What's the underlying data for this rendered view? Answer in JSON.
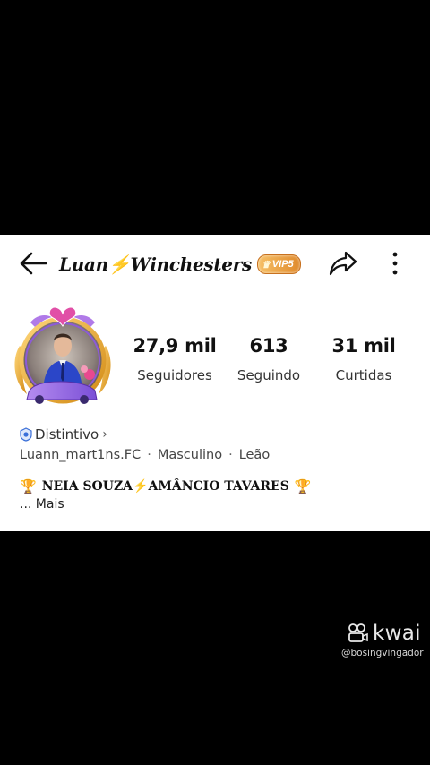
{
  "header": {
    "title": "Luan⚡Winchesters",
    "vip_label": "VIP5"
  },
  "stats": {
    "followers_value": "27,9 mil",
    "followers_label": "Seguidores",
    "following_value": "613",
    "following_label": "Seguindo",
    "likes_value": "31 mil",
    "likes_label": "Curtidas"
  },
  "profile": {
    "badge_label": "Distintivo",
    "username": "Luann_mart1ns.FC",
    "gender": "Masculino",
    "sign": "Leão",
    "bio_left": "NEIA SOUZA",
    "bio_right": "AMÂNCIO TAVARES",
    "more_label": "...  Mais"
  },
  "watermark": {
    "brand": "kwai",
    "handle": "@bosingvingador"
  },
  "icons": {
    "back": "arrow-left-icon",
    "share": "share-arrow-icon",
    "more": "vertical-dots-icon",
    "badge": "badge-icon",
    "trophy": "trophy-icon",
    "bolt": "lightning-icon",
    "kwai": "kwai-logo-icon"
  },
  "colors": {
    "vip_gradient_start": "#f6c066",
    "vip_gradient_end": "#e08a2c",
    "badge_blue": "#3a6fd8",
    "trophy_gold": "#d99a13"
  }
}
